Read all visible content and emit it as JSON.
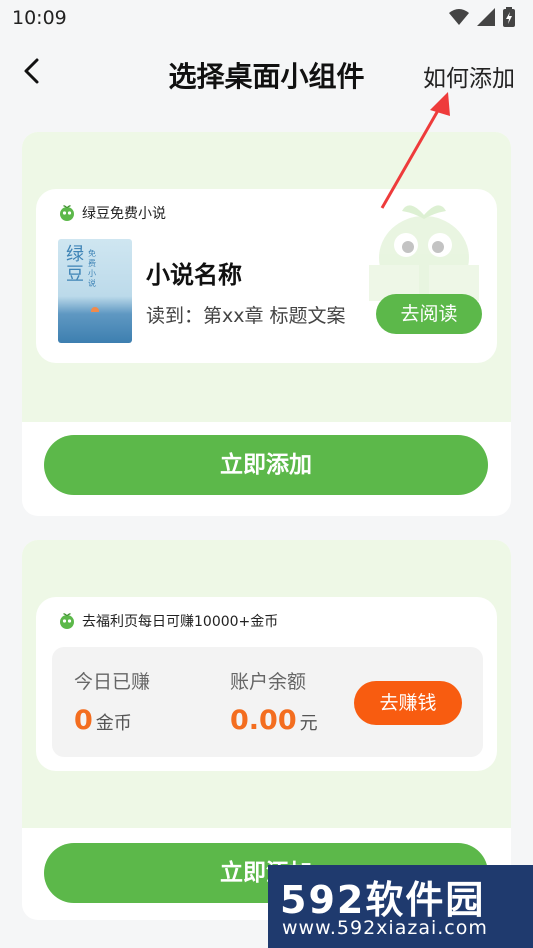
{
  "status": {
    "time": "10:09"
  },
  "nav": {
    "title": "选择桌面小组件",
    "how_to_add": "如何添加"
  },
  "widget1": {
    "app_name": "绿豆免费小说",
    "cover_title": "绿豆",
    "cover_subtitle": "免费小说",
    "book_name": "小说名称",
    "progress": "读到：第xx章 标题文案",
    "read_button": "去阅读",
    "add_button": "立即添加"
  },
  "widget2": {
    "app_name": "去福利页每日可赚10000+金币",
    "today_label": "今日已赚",
    "today_value": "0",
    "today_unit": "金币",
    "balance_label": "账户余额",
    "balance_value": "0.00",
    "balance_unit": "元",
    "earn_button": "去赚钱",
    "add_button": "立即添加"
  },
  "watermark": {
    "brand": "592软件园",
    "url": "www.592xiazai.com"
  },
  "colors": {
    "green": "#5cb84a",
    "orange": "#f85c10",
    "card_tint": "#eef8e6"
  }
}
